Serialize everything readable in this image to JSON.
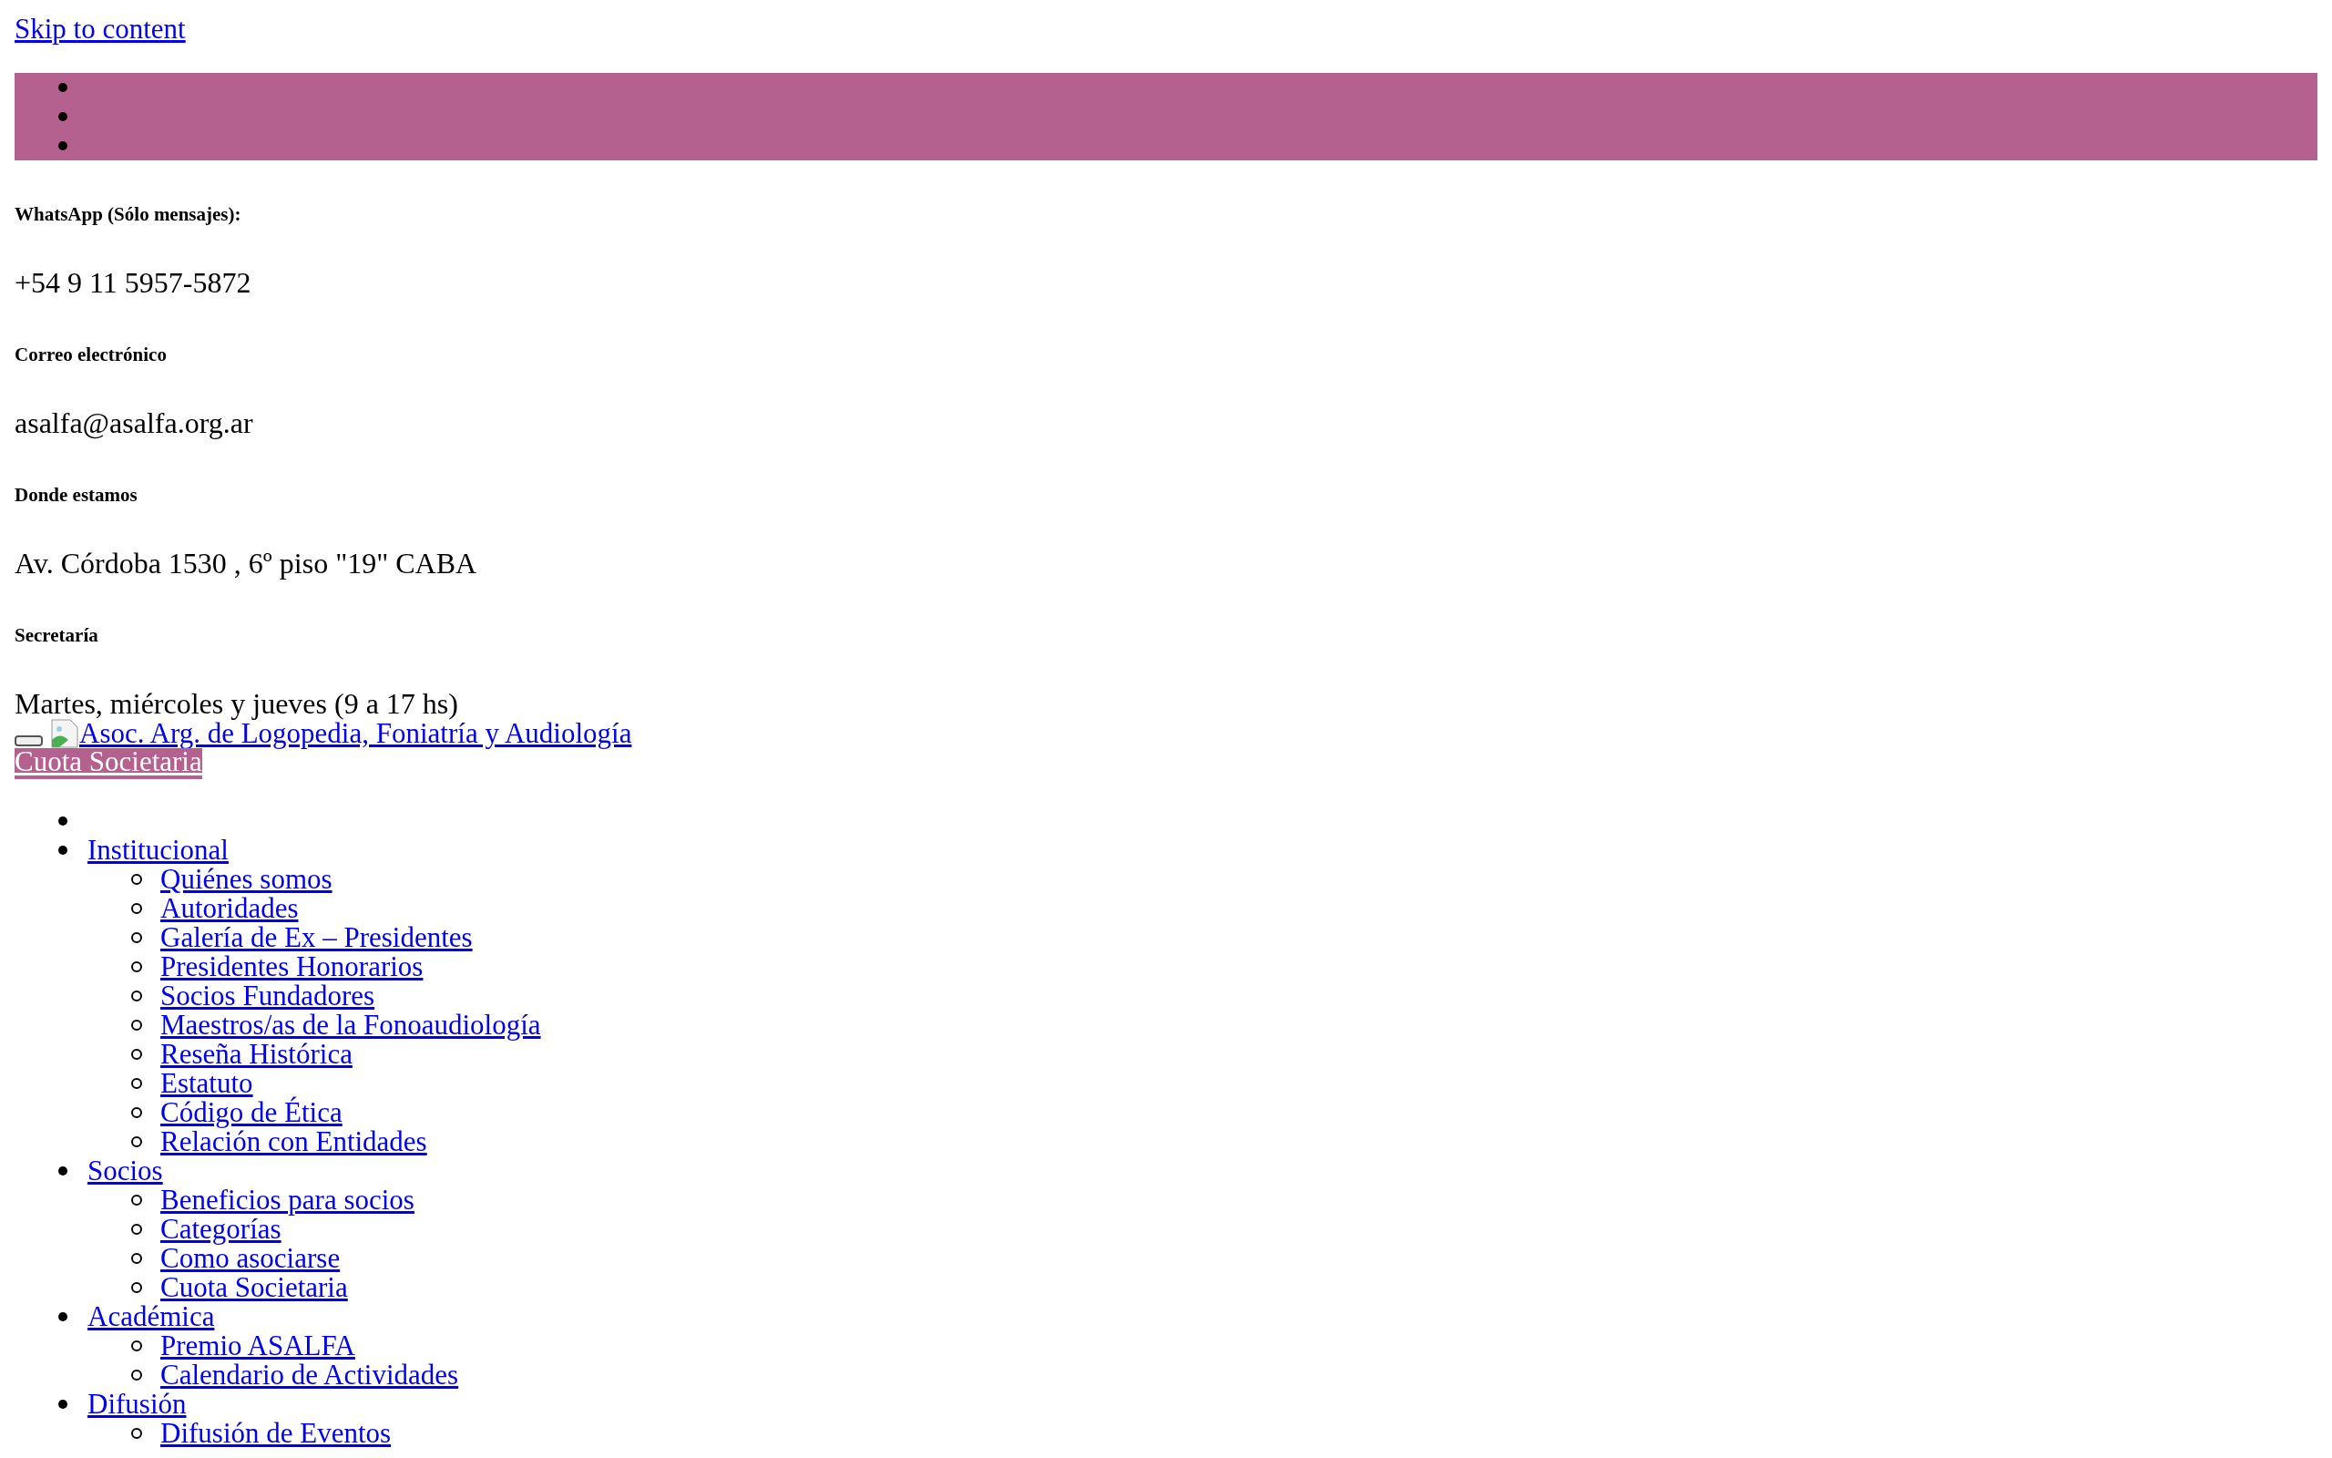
{
  "skip_link": "Skip to content",
  "top_bar": {
    "items": [
      {
        "kind": "empty"
      },
      {
        "kind": "empty"
      },
      {
        "kind": "empty"
      }
    ]
  },
  "contact": [
    {
      "heading": "WhatsApp (Sólo mensajes):",
      "text": "+54 9 11 5957-5872"
    },
    {
      "heading": "Correo electrónico",
      "text": "asalfa@asalfa.org.ar"
    },
    {
      "heading": "Donde estamos",
      "text": "Av. Córdoba 1530 , 6º piso \"19\" CABA"
    },
    {
      "heading": "Secretaría",
      "text": "Martes, miércoles y jueves (9 a 17 hs)"
    }
  ],
  "header": {
    "logo_link": "Asoc. Arg. de Logopedia, Foniatría y Audiología",
    "cta": "Cuota Societaria"
  },
  "nav": [
    {
      "kind": "empty"
    },
    {
      "kind": "link",
      "label": "Institucional",
      "children": [
        {
          "label": "Quiénes somos"
        },
        {
          "label": "Autoridades"
        },
        {
          "label": "Galería de Ex – Presidentes"
        },
        {
          "label": "Presidentes Honorarios"
        },
        {
          "label": "Socios Fundadores"
        },
        {
          "label": "Maestros/as de la Fonoaudiología"
        },
        {
          "label": "Reseña Histórica"
        },
        {
          "label": "Estatuto"
        },
        {
          "label": "Código de Ética"
        },
        {
          "label": "Relación con Entidades"
        }
      ]
    },
    {
      "kind": "link",
      "label": "Socios",
      "children": [
        {
          "label": "Beneficios para socios"
        },
        {
          "label": "Categorías"
        },
        {
          "label": "Como asociarse"
        },
        {
          "label": "Cuota Societaria"
        }
      ]
    },
    {
      "kind": "link",
      "label": "Académica",
      "children": [
        {
          "label": "Premio ASALFA"
        },
        {
          "label": "Calendario de Actividades"
        }
      ]
    },
    {
      "kind": "link",
      "label": "Difusión",
      "children": [
        {
          "label": "Difusión de Eventos"
        }
      ]
    }
  ]
}
